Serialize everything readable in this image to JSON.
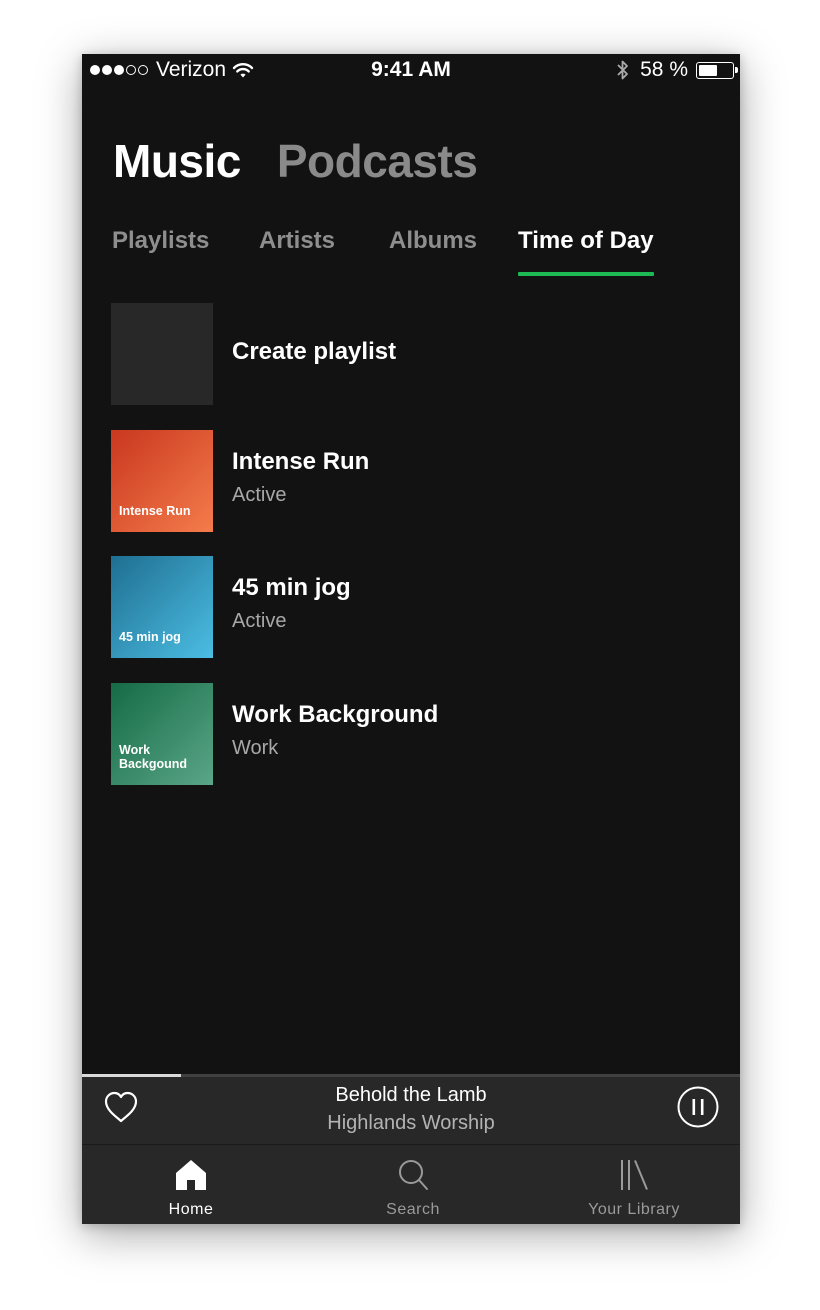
{
  "status_bar": {
    "carrier": "Verizon",
    "time": "9:41 AM",
    "battery": "58 %",
    "battery_level": 0.58,
    "signal_bars_full": 3,
    "signal_bars_total": 5,
    "icons": [
      "signal-dots-icon",
      "wifi-icon",
      "bluetooth-icon",
      "battery-icon"
    ]
  },
  "header": {
    "tabs": [
      {
        "label": "Music",
        "active": true
      },
      {
        "label": "Podcasts",
        "active": false
      }
    ]
  },
  "sub_tabs": [
    {
      "label": "Playlists",
      "active": false
    },
    {
      "label": "Artists",
      "active": false
    },
    {
      "label": "Albums",
      "active": false
    },
    {
      "label": "Time of Day",
      "active": true
    }
  ],
  "playlists": [
    {
      "title": "Create playlist",
      "subtitle": "",
      "cover_text": "",
      "cover_colors": [
        "#282828",
        "#282828"
      ]
    },
    {
      "title": "Intense Run",
      "subtitle": "Active",
      "cover_text": "Intense Run",
      "cover_colors": [
        "#c9371f",
        "#f47c4b"
      ]
    },
    {
      "title": "45 min jog",
      "subtitle": "Active",
      "cover_text": "45 min jog",
      "cover_colors": [
        "#1e6f91",
        "#4cbde3"
      ]
    },
    {
      "title": "Work Background",
      "subtitle": "Work",
      "cover_text": "Work Backgound",
      "cover_colors": [
        "#156b45",
        "#5aa688"
      ]
    }
  ],
  "now_playing": {
    "title": "Behold the Lamb",
    "artist": "Highlands Worship",
    "progress": 0.15
  },
  "bottom_nav": [
    {
      "label": "Home",
      "icon": "home-icon",
      "active": true
    },
    {
      "label": "Search",
      "icon": "search-icon",
      "active": false
    },
    {
      "label": "Your Library",
      "icon": "library-icon",
      "active": false
    }
  ],
  "colors": {
    "background": "#121212",
    "accent": "#1db954",
    "surface": "#282828"
  }
}
